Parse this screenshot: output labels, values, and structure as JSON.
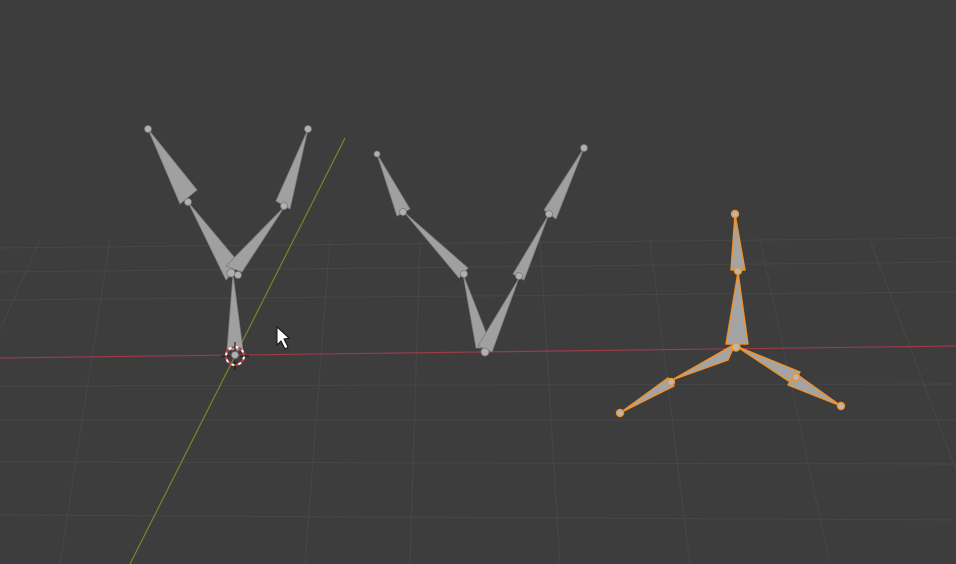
{
  "viewport": {
    "name": "3d-viewport",
    "background": "#3d3d3d",
    "grid_color": "#4a4a4a",
    "x_axis_color": "#9a3a4a",
    "y_axis_color": "#6e8a2a"
  },
  "armatures": [
    {
      "name": "armature-y-shape",
      "selected": false,
      "bone_color": "#9e9e9e",
      "joint_color": "#a8a8a8"
    },
    {
      "name": "armature-v-shape",
      "selected": false,
      "bone_color": "#9e9e9e",
      "joint_color": "#a8a8a8"
    },
    {
      "name": "armature-tripod",
      "selected": true,
      "bone_color": "#9e9e9e",
      "outline_color": "#f0922a"
    }
  ],
  "cursor": {
    "name": "3d-cursor-icon"
  },
  "pointer": {
    "name": "mouse-pointer-icon"
  }
}
